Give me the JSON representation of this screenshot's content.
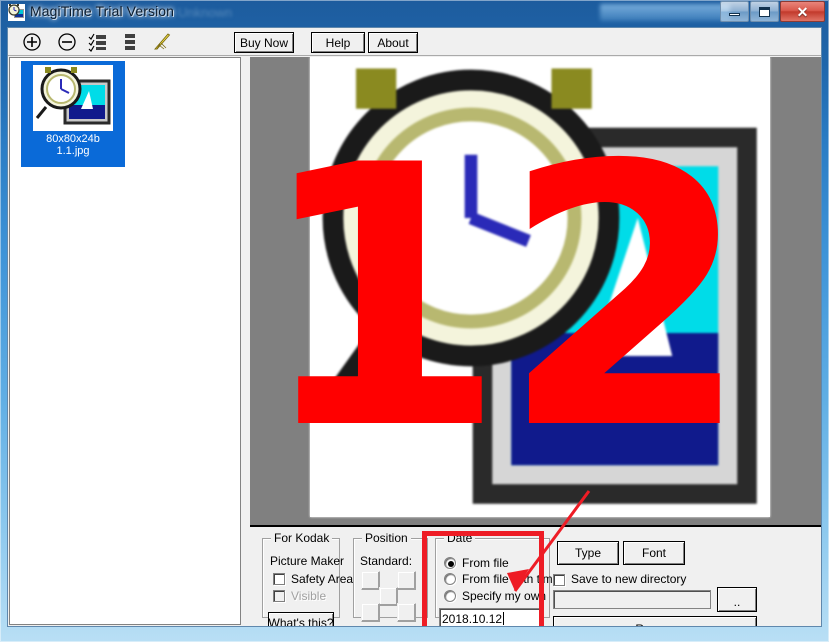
{
  "window": {
    "title": "MagiTime Trial Version",
    "ghost_title": "Unknown",
    "icon": "magitime-app-icon",
    "controls": {
      "minimize": "minimize-button",
      "maximize": "maximize-button",
      "close": "close-button",
      "close_glyph": "✕"
    }
  },
  "toolbar": {
    "icons": [
      {
        "name": "add-icon",
        "glyph": "+"
      },
      {
        "name": "remove-icon",
        "glyph": "−"
      },
      {
        "name": "select-all-list-icon",
        "glyph": ""
      },
      {
        "name": "list-icon",
        "glyph": ""
      },
      {
        "name": "clear-broom-icon",
        "glyph": ""
      }
    ],
    "buttons": [
      {
        "name": "buy-now-button",
        "label": "Buy Now"
      },
      {
        "name": "help-button",
        "label": "Help"
      },
      {
        "name": "about-button",
        "label": "About"
      }
    ]
  },
  "filelist": {
    "items": [
      {
        "dimensions": "80x80x24b",
        "filename": "1.1.jpg",
        "selected": true
      }
    ]
  },
  "preview": {
    "overlay_text": "12",
    "overlay_color": "#ff0000",
    "background_color": "#808080"
  },
  "options": {
    "kodak": {
      "title": "For Kodak",
      "subtitle": "Picture Maker",
      "safety_area": {
        "label": "Safety Area",
        "checked": false,
        "enabled": true
      },
      "visible": {
        "label": "Visible",
        "checked": false,
        "enabled": false
      },
      "whats_this": "What's this?"
    },
    "position": {
      "title": "Position",
      "standard_label": "Standard:",
      "cells": [
        "top-left",
        "top-right",
        "center",
        "bottom-left",
        "bottom-right"
      ]
    },
    "date": {
      "title": "Date",
      "radios": [
        {
          "label": "From file",
          "selected": true
        },
        {
          "label": "From file with time",
          "selected": false
        },
        {
          "label": "Specify my own",
          "selected": false
        }
      ],
      "value": "2018.10.12"
    },
    "right": {
      "type_button": "Type",
      "font_button": "Font",
      "save_new_dir": {
        "label": "Save to new directory",
        "checked": false
      },
      "dir_path": "",
      "browse_button": "..",
      "run_button": "Run >>"
    }
  },
  "annotations": {
    "highlight_box_color": "#ee1c25",
    "arrow_color": "#ee1c25"
  }
}
